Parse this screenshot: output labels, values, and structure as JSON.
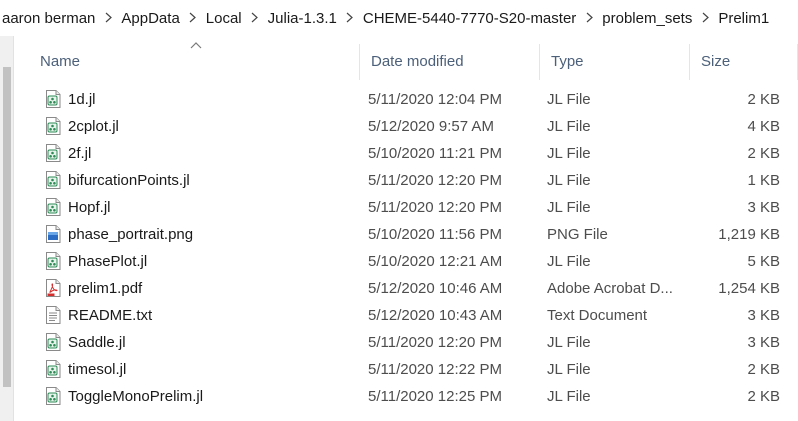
{
  "breadcrumb": [
    "aaron berman",
    "AppData",
    "Local",
    "Julia-1.3.1",
    "CHEME-5440-7770-S20-master",
    "problem_sets",
    "Prelim1"
  ],
  "columns": {
    "name": "Name",
    "date": "Date modified",
    "type": "Type",
    "size": "Size"
  },
  "files": [
    {
      "name": "1d.jl",
      "date": "5/11/2020 12:04 PM",
      "type": "JL File",
      "size": "2 KB",
      "icon": "julia-file-icon"
    },
    {
      "name": "2cplot.jl",
      "date": "5/12/2020 9:57 AM",
      "type": "JL File",
      "size": "4 KB",
      "icon": "julia-file-icon"
    },
    {
      "name": "2f.jl",
      "date": "5/10/2020 11:21 PM",
      "type": "JL File",
      "size": "2 KB",
      "icon": "julia-file-icon"
    },
    {
      "name": "bifurcationPoints.jl",
      "date": "5/11/2020 12:20 PM",
      "type": "JL File",
      "size": "1 KB",
      "icon": "julia-file-icon"
    },
    {
      "name": "Hopf.jl",
      "date": "5/11/2020 12:20 PM",
      "type": "JL File",
      "size": "3 KB",
      "icon": "julia-file-icon"
    },
    {
      "name": "phase_portrait.png",
      "date": "5/10/2020 11:56 PM",
      "type": "PNG File",
      "size": "1,219 KB",
      "icon": "image-file-icon"
    },
    {
      "name": "PhasePlot.jl",
      "date": "5/10/2020 12:21 AM",
      "type": "JL File",
      "size": "5 KB",
      "icon": "julia-file-icon"
    },
    {
      "name": "prelim1.pdf",
      "date": "5/12/2020 10:46 AM",
      "type": "Adobe Acrobat D...",
      "size": "1,254 KB",
      "icon": "pdf-file-icon"
    },
    {
      "name": "README.txt",
      "date": "5/12/2020 10:43 AM",
      "type": "Text Document",
      "size": "3 KB",
      "icon": "text-file-icon"
    },
    {
      "name": "Saddle.jl",
      "date": "5/11/2020 12:20 PM",
      "type": "JL File",
      "size": "3 KB",
      "icon": "julia-file-icon"
    },
    {
      "name": "timesol.jl",
      "date": "5/11/2020 12:22 PM",
      "type": "JL File",
      "size": "2 KB",
      "icon": "julia-file-icon"
    },
    {
      "name": "ToggleMonoPrelim.jl",
      "date": "5/11/2020 12:25 PM",
      "type": "JL File",
      "size": "2 KB",
      "icon": "julia-file-icon"
    }
  ],
  "sort": {
    "column": "name",
    "direction": "ascending"
  }
}
